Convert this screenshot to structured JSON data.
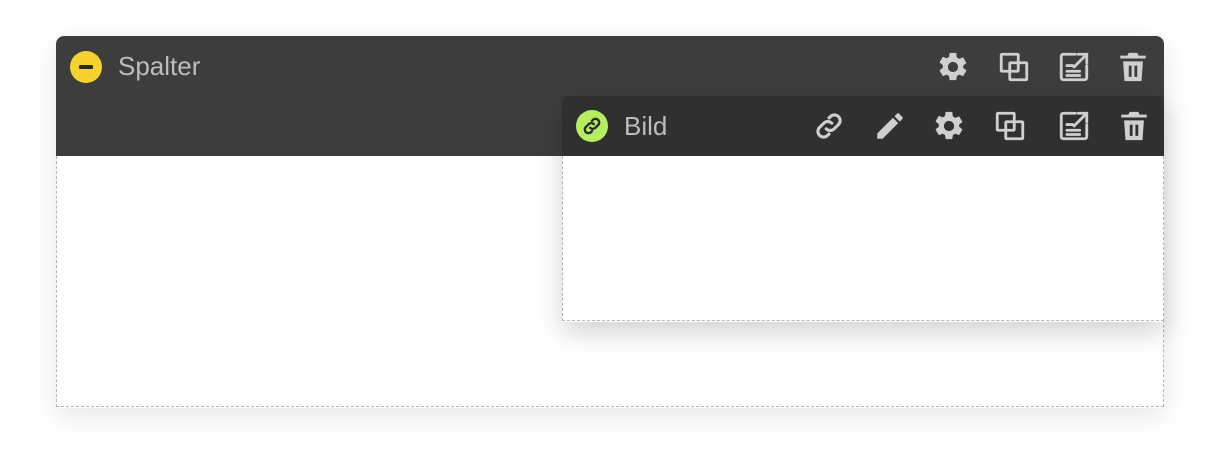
{
  "outer_block": {
    "title": "Spalter",
    "badge_icon": "minus-circle-icon",
    "badge_color": "#f5d22e",
    "actions": [
      "settings",
      "duplicate",
      "export",
      "delete"
    ]
  },
  "inner_block": {
    "title": "Bild",
    "badge_icon": "link-icon",
    "badge_color": "#b6ec5f",
    "actions": [
      "link",
      "edit",
      "settings",
      "duplicate",
      "export",
      "delete"
    ]
  },
  "colors": {
    "header_dark": "#3d3d3d",
    "inner_header_dark": "#303030",
    "icon": "#cfcfcf",
    "title_text": "#bdbdbd",
    "dashed_border": "#b5b5b5"
  }
}
